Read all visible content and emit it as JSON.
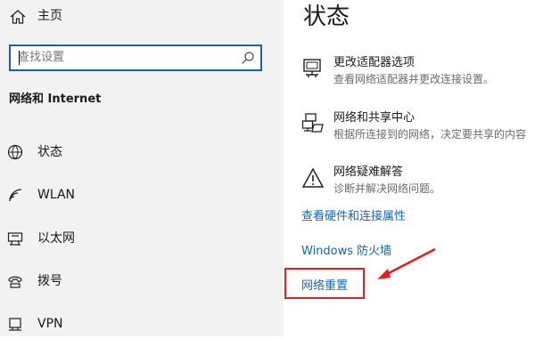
{
  "sidebar": {
    "home_label": "主页",
    "search_placeholder": "查找设置",
    "section_title": "网络和 Internet",
    "items": [
      {
        "label": "状态",
        "icon": "status-icon"
      },
      {
        "label": "WLAN",
        "icon": "wifi-icon"
      },
      {
        "label": "以太网",
        "icon": "ethernet-icon"
      },
      {
        "label": "拨号",
        "icon": "dialup-icon"
      },
      {
        "label": "VPN",
        "icon": "vpn-icon"
      }
    ]
  },
  "main": {
    "title": "状态",
    "options": [
      {
        "title": "更改适配器选项",
        "desc": "查看网络适配器并更改连接设置。",
        "icon": "adapter-icon"
      },
      {
        "title": "网络和共享中心",
        "desc": "根据所连接到的网络，决定要共享的内容",
        "icon": "sharing-center-icon"
      },
      {
        "title": "网络疑难解答",
        "desc": "诊断并解决网络问题。",
        "icon": "warning-icon"
      }
    ],
    "links": {
      "hardware": "查看硬件和连接属性",
      "firewall": "Windows 防火墙",
      "reset": "网络重置"
    }
  },
  "colors": {
    "link": "#1366b8",
    "highlight": "#e02020",
    "sidebar_bg": "#f2f2f2",
    "search_border": "#1a5fa8"
  }
}
